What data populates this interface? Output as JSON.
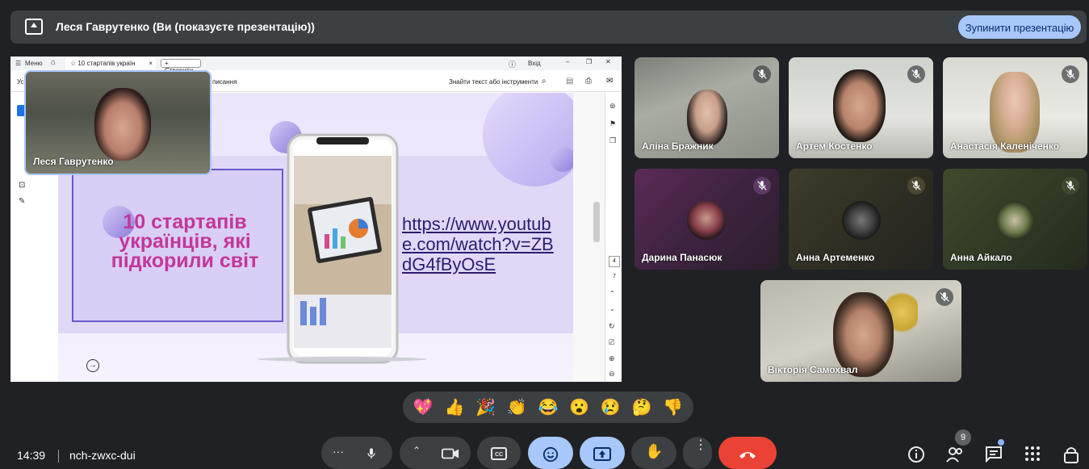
{
  "banner": {
    "title": "Леся Гаврутенко (Ви (показуєте презентацію))",
    "stop_button": "Зупинити презентацію"
  },
  "share": {
    "menu_label": "Меню",
    "tab_label": "10 стартапів україн",
    "new_tab_label": "+ Створити",
    "login_label": "Вхід",
    "toolbar_left": "Ус",
    "toolbar_mid": "писання",
    "search_label": "Знайти текст або інструменти",
    "slide_title": "10 стартапів українців, які підкорили світ",
    "slide_link": "https://www.youtube.com/watch?v=ZBdG4fByOsE",
    "page_current": "4",
    "page_total": "7"
  },
  "self": {
    "name": "Леся Гаврутенко"
  },
  "participants": [
    {
      "name": "Аліна Бражник"
    },
    {
      "name": "Артем Костенко"
    },
    {
      "name": "Анастасія Каленіченко"
    },
    {
      "name": "Дарина Панасюк"
    },
    {
      "name": "Анна Артеменко"
    },
    {
      "name": "Анна Айкало"
    },
    {
      "name": "Вікторія Самохвал"
    }
  ],
  "reactions": [
    "💖",
    "👍",
    "🎉",
    "👏",
    "😂",
    "😮",
    "😢",
    "🤔",
    "👎"
  ],
  "footer": {
    "time": "14:39",
    "meeting_code": "nch-zwxc-dui",
    "participants_count": "9"
  },
  "colors": {
    "accent": "#a8c7fa",
    "end_call": "#ea4335",
    "slide_title": "#c2379a"
  }
}
